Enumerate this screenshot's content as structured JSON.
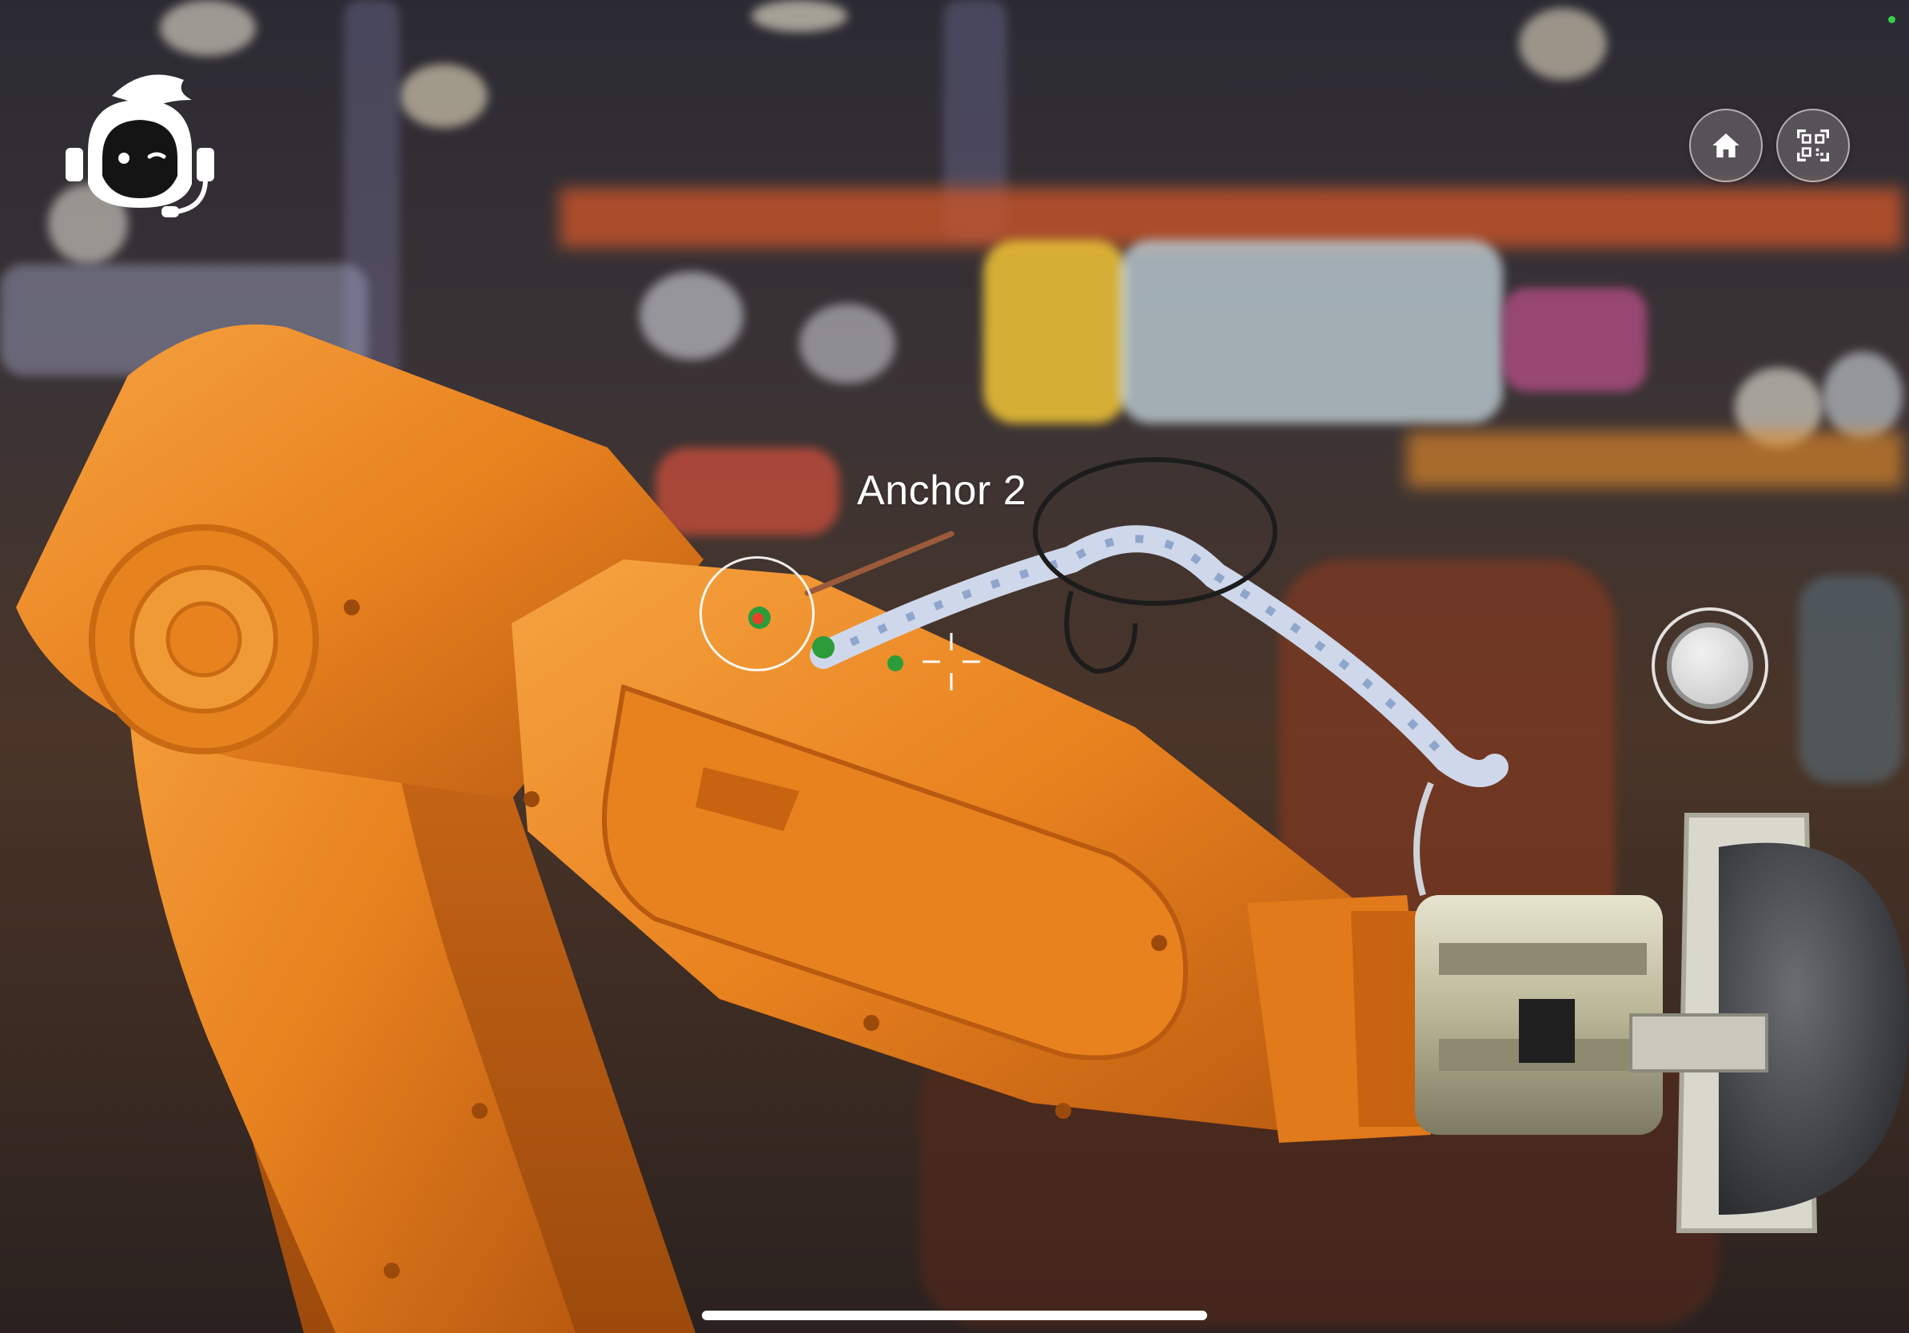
{
  "scene": {
    "anchor_label": "Anchor 2"
  },
  "buttons": {
    "home_icon": "home-icon",
    "qr_icon": "qr-scan-icon",
    "capture_icon": "capture-button"
  },
  "avatar": {
    "icon": "support-agent-icon"
  },
  "colors": {
    "robot_orange": "#e8821f",
    "anchor_line": "#9b5a3a",
    "status_green": "#35d04a"
  }
}
